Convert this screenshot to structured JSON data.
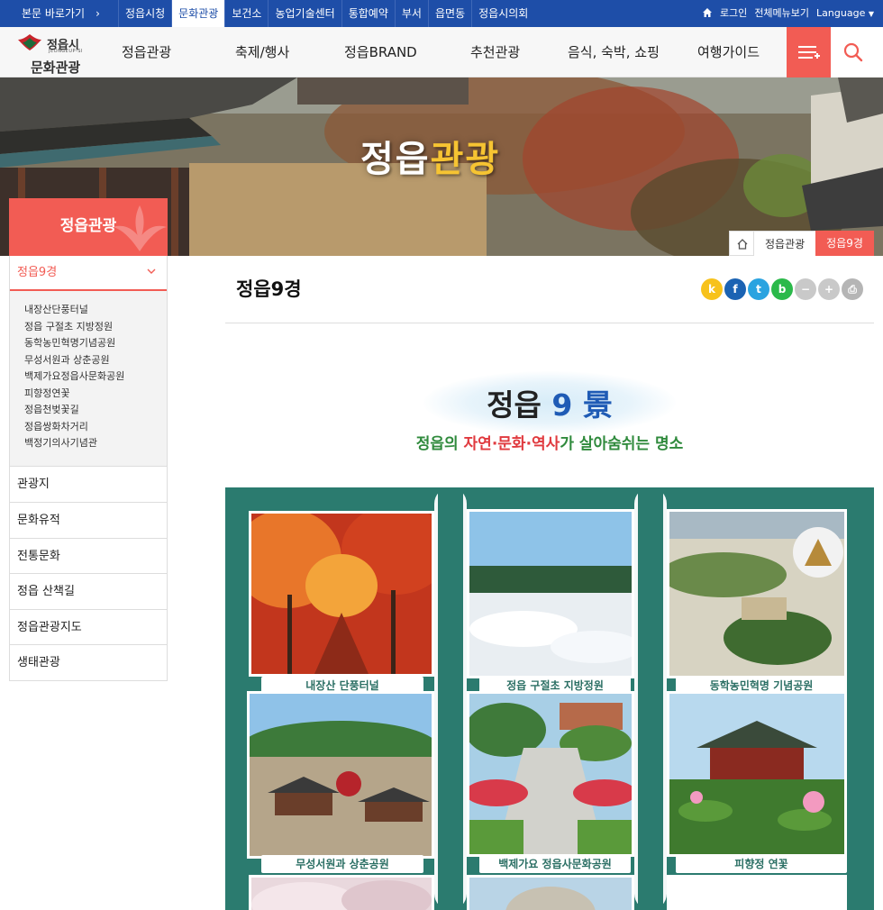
{
  "topbar": {
    "skip_label": "본문 바로가기",
    "sites": [
      "정읍시청",
      "문화관광",
      "보건소",
      "농업기술센터",
      "통합예약",
      "부서",
      "읍면동",
      "정읍시의회"
    ],
    "active_site": "문화관광",
    "login_label": "로그인",
    "allmenu_label": "전체메뉴보기",
    "language_label": "Language"
  },
  "logo": {
    "city": "정읍시",
    "city_en": "JEONGEUP-SI",
    "name": "문화관광"
  },
  "gnb": {
    "items": [
      "정읍관광",
      "축제/행사",
      "정읍BRAND",
      "추천관광",
      "음식, 숙박, 쇼핑",
      "여행가이드"
    ]
  },
  "hero": {
    "title_a": "정읍",
    "title_b": "관광"
  },
  "breadcrumb": {
    "level1": "정읍관광",
    "level2": "정읍9경"
  },
  "sidebar": {
    "heading": "정읍관광",
    "current": "정읍9경",
    "sub_items": [
      "내장산단풍터널",
      "정읍 구절초 지방정원",
      "동학농민혁명기념공원",
      "무성서원과 상춘공원",
      "백제가요정읍사문화공원",
      "피향정연꽃",
      "정읍천벚꽃길",
      "정읍쌍화차거리",
      "백정기의사기념관"
    ],
    "items": [
      "관광지",
      "문화유적",
      "전통문화",
      "정읍 산책길",
      "정읍관광지도",
      "생태관광"
    ]
  },
  "content": {
    "title": "정읍9경",
    "share": [
      {
        "icon": "kakaostory-icon",
        "glyph": "k",
        "color": "#f7c21b"
      },
      {
        "icon": "facebook-icon",
        "glyph": "f",
        "color": "#1b63b3"
      },
      {
        "icon": "twitter-icon",
        "glyph": "t",
        "color": "#2aa3e0"
      },
      {
        "icon": "band-icon",
        "glyph": "b",
        "color": "#2bb94a"
      },
      {
        "icon": "zoom-out-icon",
        "glyph": "−",
        "color": "#c9c9c9"
      },
      {
        "icon": "zoom-in-icon",
        "glyph": "+",
        "color": "#c9c9c9"
      },
      {
        "icon": "print-icon",
        "glyph": "⎙",
        "color": "#b5b5b5"
      }
    ]
  },
  "poster": {
    "title_a": "정읍",
    "title_num": "9",
    "title_b": "景",
    "sub_a": "정읍의 ",
    "sub_red": "자연·문화·역사",
    "sub_b": "가 살아숨쉬는 명소",
    "captions": [
      "내장산 단풍터널",
      "정읍 구절초 지방정원",
      "동학농민혁명 기념공원",
      "무성서원과 상춘공원",
      "백제가요 정읍사문화공원",
      "피향정 연꽃"
    ]
  }
}
